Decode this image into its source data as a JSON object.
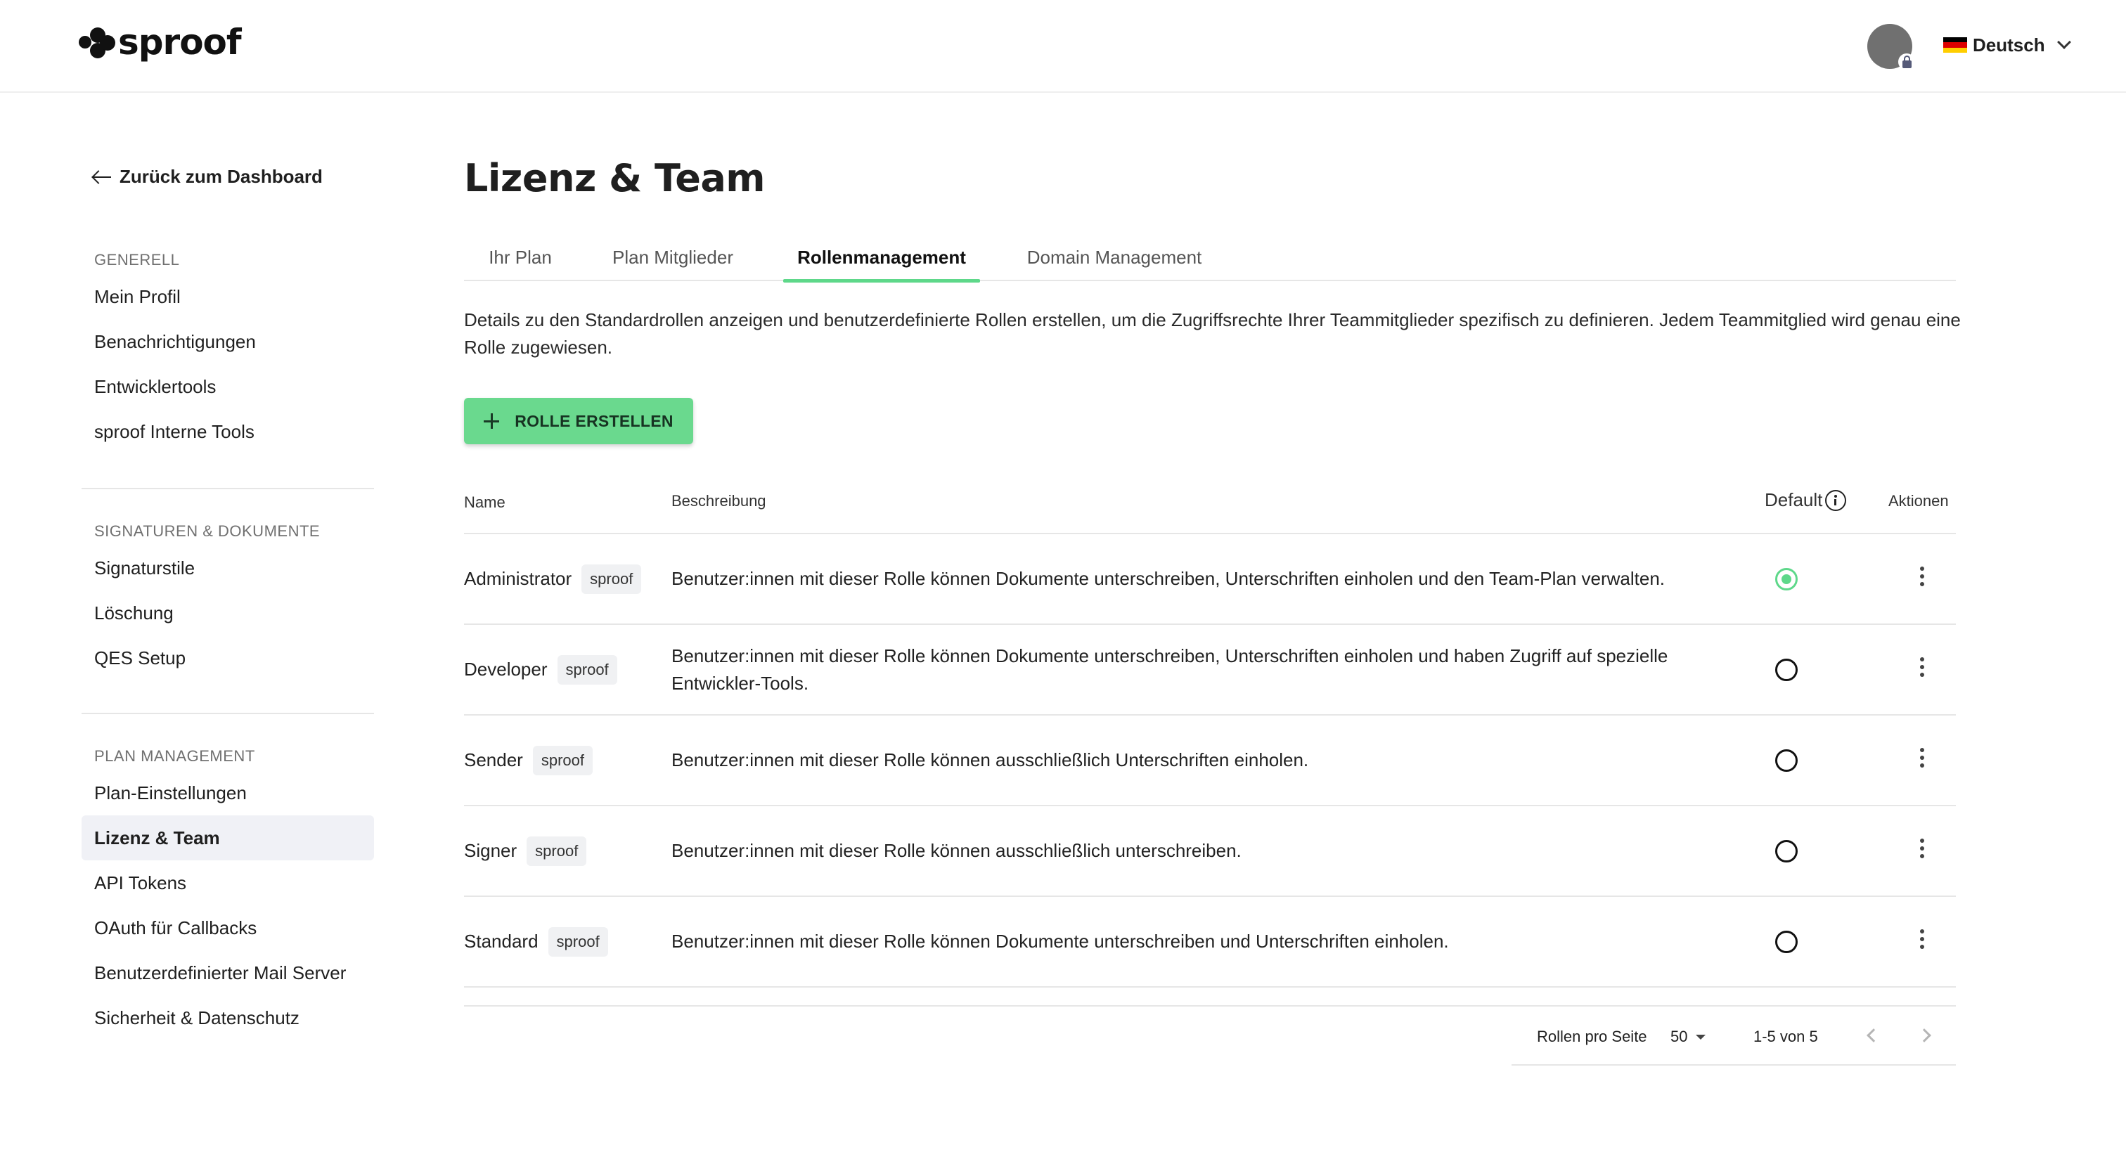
{
  "brand": {
    "name": "sproof",
    "accent_color": "#6ad98e"
  },
  "header": {
    "language": "Deutsch",
    "flag_colors": [
      "#000000",
      "#dd0000",
      "#ffce00"
    ],
    "avatar_icon": "user-avatar-locked"
  },
  "sidebar": {
    "back_label": "Zurück zum Dashboard",
    "sections": [
      {
        "heading": "GENERELL",
        "items": [
          "Mein Profil",
          "Benachrichtigungen",
          "Entwicklertools",
          "sproof Interne Tools"
        ]
      },
      {
        "heading": "SIGNATUREN & DOKUMENTE",
        "items": [
          "Signaturstile",
          "Löschung",
          "QES Setup"
        ]
      },
      {
        "heading": "PLAN MANAGEMENT",
        "items": [
          "Plan-Einstellungen",
          "Lizenz & Team",
          "API Tokens",
          "OAuth für Callbacks",
          "Benutzerdefinierter Mail Server",
          "Sicherheit & Datenschutz"
        ]
      }
    ],
    "active_item": "Lizenz & Team"
  },
  "main": {
    "title": "Lizenz & Team",
    "tabs": [
      {
        "label": "Ihr Plan",
        "active": false
      },
      {
        "label": "Plan Mitglieder",
        "active": false
      },
      {
        "label": "Rollenmanagement",
        "active": true
      },
      {
        "label": "Domain Management",
        "active": false
      }
    ],
    "description": "Details zu den Standardrollen anzeigen und benutzerdefinierte Rollen erstellen, um die Zugriffsrechte Ihrer Teammitglieder spezifisch zu definieren. Jedem Teammitglied wird genau eine Rolle zugewiesen.",
    "create_button": "ROLLE ERSTELLEN",
    "table": {
      "columns": {
        "name": "Name",
        "description": "Beschreibung",
        "default": "Default",
        "actions": "Aktionen"
      },
      "rows": [
        {
          "name": "Administrator",
          "badge": "sproof",
          "description": "Benutzer:innen mit dieser Rolle können Dokumente unterschreiben, Unterschriften einholen und den Team-Plan verwalten.",
          "default": true
        },
        {
          "name": "Developer",
          "badge": "sproof",
          "description": "Benutzer:innen mit dieser Rolle können Dokumente unterschreiben, Unterschriften einholen und haben Zugriff auf spezielle Entwickler-Tools.",
          "default": false
        },
        {
          "name": "Sender",
          "badge": "sproof",
          "description": "Benutzer:innen mit dieser Rolle können ausschließlich Unterschriften einholen.",
          "default": false
        },
        {
          "name": "Signer",
          "badge": "sproof",
          "description": "Benutzer:innen mit dieser Rolle können ausschließlich unterschreiben.",
          "default": false
        },
        {
          "name": "Standard",
          "badge": "sproof",
          "description": "Benutzer:innen mit dieser Rolle können Dokumente unterschreiben und Unterschriften einholen.",
          "default": false
        }
      ]
    },
    "pagination": {
      "per_page_label": "Rollen pro Seite",
      "per_page": "50",
      "range": "1-5 von 5"
    }
  }
}
